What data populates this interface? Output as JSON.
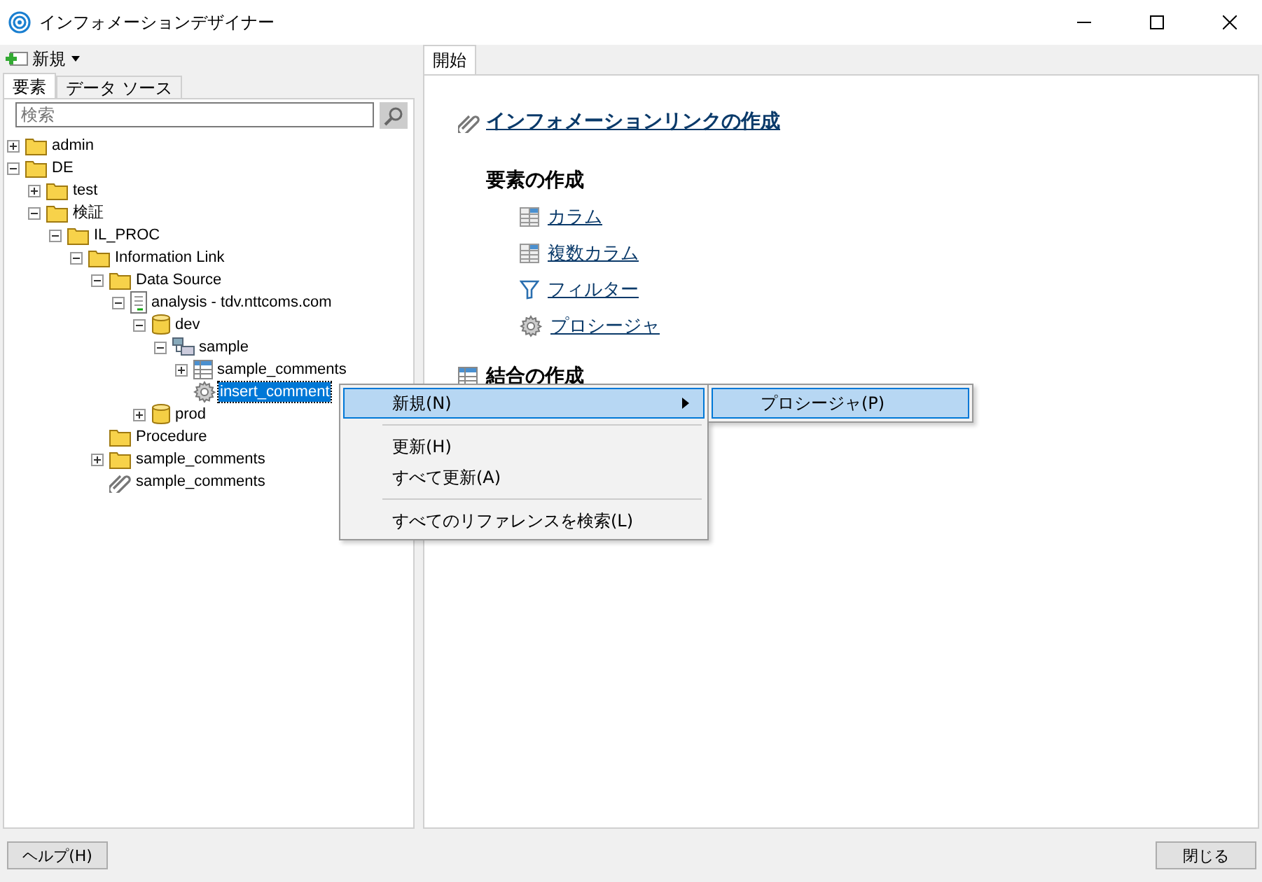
{
  "window": {
    "title": "インフォメーションデザイナー"
  },
  "toolbar": {
    "new_button": "新規"
  },
  "left_tabs": [
    {
      "label": "要素",
      "selected": true
    },
    {
      "label": "データ ソース",
      "selected": false
    }
  ],
  "search": {
    "placeholder": "検索"
  },
  "tree": [
    {
      "label": "admin",
      "kind": "folder",
      "expanded": false,
      "selected": false
    },
    {
      "label": "DE",
      "kind": "folder",
      "expanded": true,
      "selected": false,
      "children": [
        {
          "label": "test",
          "kind": "folder",
          "expanded": false,
          "selected": false
        },
        {
          "label": "検証",
          "kind": "folder",
          "expanded": true,
          "selected": false,
          "children": [
            {
              "label": "IL_PROC",
              "kind": "folder",
              "expanded": true,
              "selected": false,
              "children": [
                {
                  "label": "Information Link",
                  "kind": "folder",
                  "expanded": true,
                  "selected": false,
                  "children": [
                    {
                      "label": "Data Source",
                      "kind": "folder",
                      "expanded": true,
                      "selected": false,
                      "children": [
                        {
                          "label": "analysis - tdv.nttcoms.com",
                          "kind": "datasource",
                          "expanded": true,
                          "selected": false,
                          "children": [
                            {
                              "label": "dev",
                              "kind": "database",
                              "expanded": true,
                              "selected": false,
                              "children": [
                                {
                                  "label": "sample",
                                  "kind": "schema",
                                  "expanded": true,
                                  "selected": false,
                                  "children": [
                                    {
                                      "label": "sample_comments",
                                      "kind": "table",
                                      "expanded": false,
                                      "selected": false
                                    },
                                    {
                                      "label": "insert_comment",
                                      "kind": "procedure",
                                      "selected": true
                                    }
                                  ]
                                }
                              ]
                            },
                            {
                              "label": "prod",
                              "kind": "database",
                              "expanded": false,
                              "selected": false
                            }
                          ]
                        }
                      ]
                    },
                    {
                      "label": "Procedure",
                      "kind": "folder",
                      "selected": false
                    },
                    {
                      "label": "sample_comments",
                      "kind": "folder",
                      "expanded": false,
                      "selected": false
                    },
                    {
                      "label": "sample_comments",
                      "kind": "link",
                      "selected": false
                    }
                  ]
                }
              ]
            }
          ]
        }
      ]
    }
  ],
  "main_tabs": [
    {
      "label": "開始",
      "selected": true
    }
  ],
  "start": {
    "create_link": "インフォメーションリンクの作成",
    "elements_heading": "要素の作成",
    "element_links": [
      {
        "label": "カラム",
        "kind": "column"
      },
      {
        "label": "複数カラム",
        "kind": "column"
      },
      {
        "label": "フィルター",
        "kind": "filter"
      },
      {
        "label": "プロシージャ",
        "kind": "procedure"
      }
    ],
    "join_heading": "結合の作成"
  },
  "context_menu": {
    "items": [
      {
        "label": "新規(N)",
        "kind": "submenu",
        "selected": true
      },
      {
        "kind": "separator"
      },
      {
        "label": "更新(H)",
        "kind": "item",
        "selected": false
      },
      {
        "label": "すべて更新(A)",
        "kind": "item",
        "selected": false
      },
      {
        "kind": "separator"
      },
      {
        "label": "すべてのリファレンスを検索(L)",
        "kind": "item",
        "selected": false
      }
    ],
    "submenu": [
      {
        "label": "プロシージャ(P)",
        "selected": true
      }
    ]
  },
  "buttons": {
    "help": "ヘルプ(H)",
    "close": "閉じる"
  }
}
